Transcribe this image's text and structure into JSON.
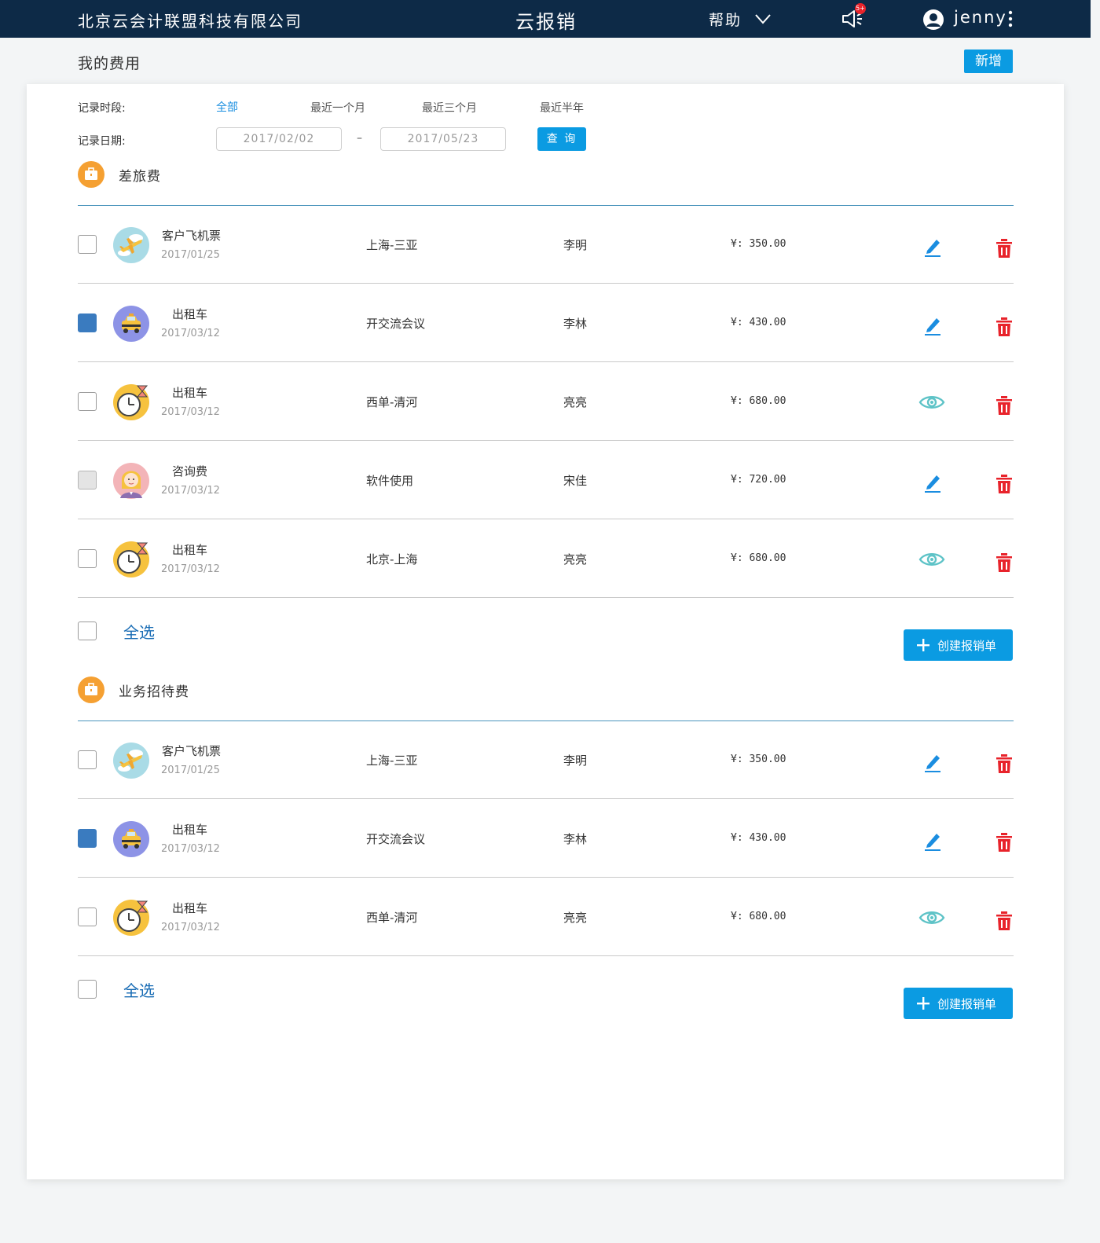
{
  "header": {
    "company": "北京云会计联盟科技有限公司",
    "app_title": "云报销",
    "help": "帮助",
    "notification_badge": "5+",
    "username": "jenny"
  },
  "page": {
    "title": "我的费用",
    "add_button": "新增"
  },
  "filters": {
    "period_label": "记录时段:",
    "period_options": [
      "全部",
      "最近一个月",
      "最近三个月",
      "最近半年"
    ],
    "period_selected": "全部",
    "date_label": "记录日期:",
    "date_from": "2017/02/02",
    "date_to": "2017/05/23",
    "date_separator": "–",
    "query_button": "查 询"
  },
  "categories": [
    {
      "title": "差旅费",
      "rows": [
        {
          "icon": "airplane-icon",
          "name": "客户飞机票",
          "date": "2017/01/25",
          "desc": "上海-三亚",
          "person": "李明",
          "amount": "¥: 350.00",
          "state": "unchecked",
          "action": "edit"
        },
        {
          "icon": "taxi-icon",
          "name": "出租车",
          "date": "2017/03/12",
          "desc": "开交流会议",
          "person": "李林",
          "amount": "¥: 430.00",
          "state": "checked",
          "action": "edit"
        },
        {
          "icon": "clock-icon",
          "name": "出租车",
          "date": "2017/03/12",
          "desc": "西单-清河",
          "person": "亮亮",
          "amount": "¥: 680.00",
          "state": "unchecked",
          "action": "view"
        },
        {
          "icon": "consultant-icon",
          "name": "咨询费",
          "date": "2017/03/12",
          "desc": "软件使用",
          "person": "宋佳",
          "amount": "¥: 720.00",
          "state": "disabled",
          "action": "edit"
        },
        {
          "icon": "clock-icon",
          "name": "出租车",
          "date": "2017/03/12",
          "desc": "北京-上海",
          "person": "亮亮",
          "amount": "¥: 680.00",
          "state": "unchecked",
          "action": "view"
        }
      ],
      "select_all": "全选",
      "create_button": "创建报销单"
    },
    {
      "title": "业务招待费",
      "rows": [
        {
          "icon": "airplane-icon",
          "name": "客户飞机票",
          "date": "2017/01/25",
          "desc": "上海-三亚",
          "person": "李明",
          "amount": "¥: 350.00",
          "state": "unchecked",
          "action": "edit"
        },
        {
          "icon": "taxi-icon",
          "name": "出租车",
          "date": "2017/03/12",
          "desc": "开交流会议",
          "person": "李林",
          "amount": "¥: 430.00",
          "state": "checked",
          "action": "edit"
        },
        {
          "icon": "clock-icon",
          "name": "出租车",
          "date": "2017/03/12",
          "desc": "西单-清河",
          "person": "亮亮",
          "amount": "¥: 680.00",
          "state": "unchecked",
          "action": "view"
        }
      ],
      "select_all": "全选",
      "create_button": "创建报销单"
    }
  ],
  "colors": {
    "topbar": "#0d2a47",
    "primary": "#0b9be2",
    "checked": "#3a7bbf",
    "delete": "#e8232b",
    "view": "#5ec3c7",
    "category_icon": "#f5a032"
  }
}
